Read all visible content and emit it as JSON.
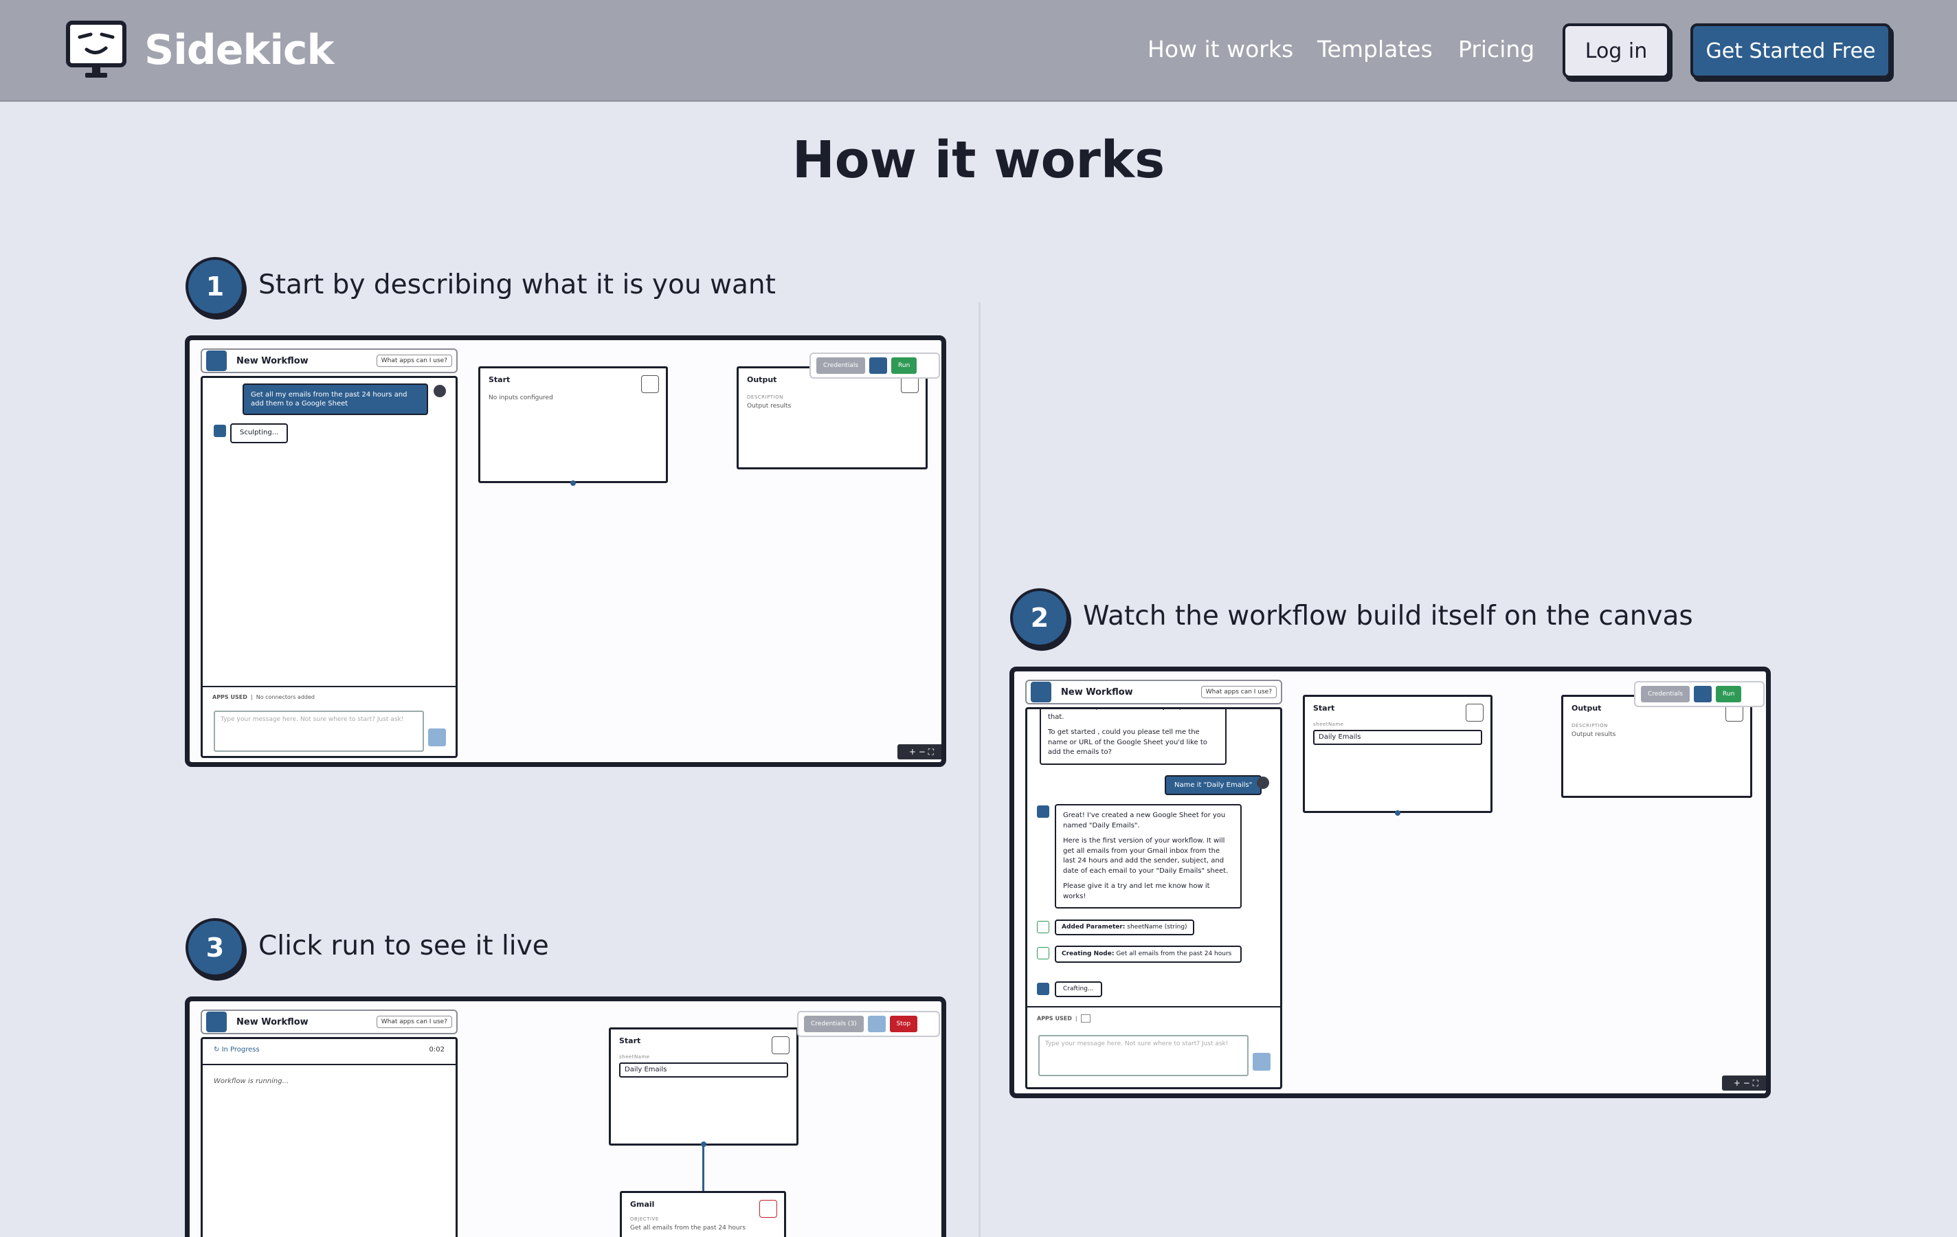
{
  "brand": {
    "name": "Sidekick"
  },
  "nav": {
    "links": [
      "How it works",
      "Templates",
      "Pricing"
    ],
    "login_label": "Log in",
    "cta_label": "Get Started Free"
  },
  "page": {
    "title": "How it works"
  },
  "steps": [
    {
      "num": "1",
      "title": "Start by describing what it is you want"
    },
    {
      "num": "2",
      "title": "Watch the workflow build itself on the canvas"
    },
    {
      "num": "3",
      "title": "Click run to see it live"
    }
  ],
  "mock": {
    "workflow_title": "New Workflow",
    "apps_button": "What apps can I use?",
    "credentials": "Credentials",
    "credentials_count": "Credentials (3)",
    "run": "Run",
    "stop": "Stop",
    "start_node": "Start",
    "no_inputs": "No inputs configured",
    "output_node": "Output",
    "description_label": "DESCRIPTION",
    "output_results": "Output results",
    "apps_used": "APPS USED",
    "no_connectors": "No connectors added",
    "input_placeholder": "Type your message here. Not sure where to start? Just ask!",
    "step1_user_msg": "Get all my emails from the past 24 hours and add them to a Google Sheet",
    "sculpting": "Sculpting...",
    "step2_top_msg": "Sounds like a plan! I can definitely help with that.",
    "step2_bot_msg1": "To get started , could you please tell me the name or URL of the Google Sheet you'd like to add the emails to?",
    "step2_user_msg": "Name it \"Daily Emails\"",
    "step2_bot_msg2a": "Great! I've created a new Google Sheet for you named \"Daily Emails\".",
    "step2_bot_msg2b": "Here is the first version of your workflow. It will get all emails from your Gmail inbox from the last 24 hours and add the sender, subject, and date of each email to your \"Daily Emails\" sheet.",
    "step2_bot_msg2c": "Please give it a try and let me know how it works!",
    "added_param_label": "Added Parameter:",
    "added_param_value": "sheetName (string)",
    "creating_node_label": "Creating Node:",
    "creating_node_value": "Get all emails from the past 24 hours",
    "crafting": "Crafting...",
    "sheet_name_label": "sheetName",
    "sheet_name_value": "Daily Emails",
    "in_progress": "In Progress",
    "timer": "0:02",
    "running": "Workflow is running...",
    "gmail_node": "Gmail",
    "objective_label": "OBJECTIVE",
    "objective_value": "Get all emails from the past 24 hours"
  },
  "colors": {
    "accent": "#2e5e8e",
    "nav_bg": "#a1a4ae",
    "page_bg": "#e5e7f0",
    "run_green": "#2f9a55",
    "stop_red": "#c4202a"
  }
}
